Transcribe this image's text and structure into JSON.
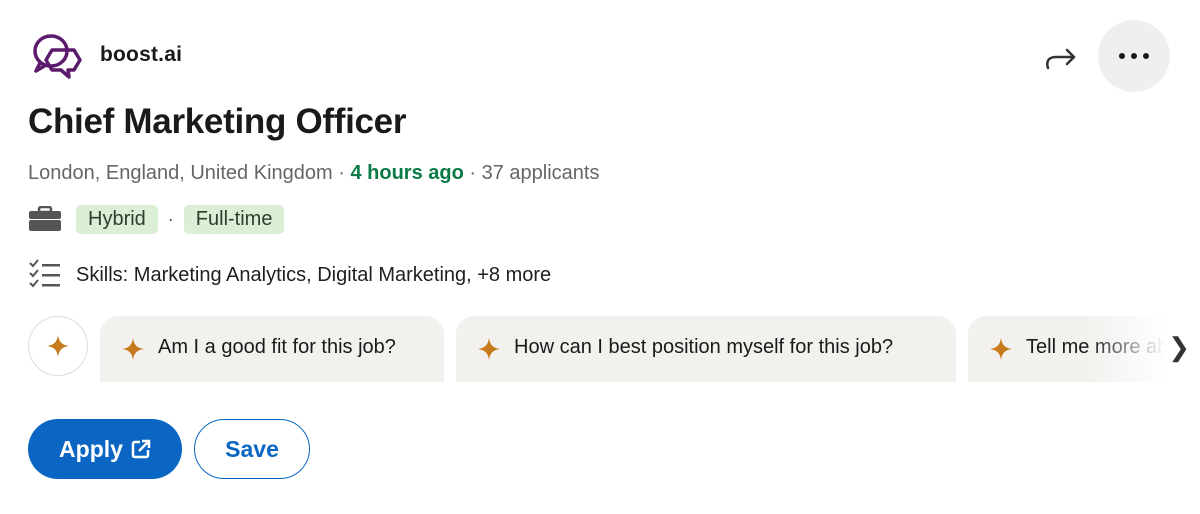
{
  "company": {
    "name": "boost.ai",
    "logo_icon": "chat-bubbles-logo-icon"
  },
  "header_actions": {
    "share_icon": "share-arrow-icon",
    "more_icon": "more-options-icon"
  },
  "job": {
    "title": "Chief Marketing Officer",
    "location": "London, England, United Kingdom",
    "separator": "·",
    "posted": "4 hours ago",
    "applicants": "37 applicants",
    "workplace_type": "Hybrid",
    "employment_type": "Full-time",
    "skills": "Skills: Marketing Analytics, Digital Marketing, +8 more"
  },
  "ai_prompts": [
    {
      "label": "Am I a good fit for this job?"
    },
    {
      "label": "How can I best position myself for this job?"
    },
    {
      "label": "Tell me more about"
    }
  ],
  "actions": {
    "apply_label": "Apply",
    "save_label": "Save"
  },
  "colors": {
    "accent": "#0a66c2",
    "green": "#0a7a46",
    "star": "#c87a1e",
    "logo": "#5b1a6b"
  }
}
